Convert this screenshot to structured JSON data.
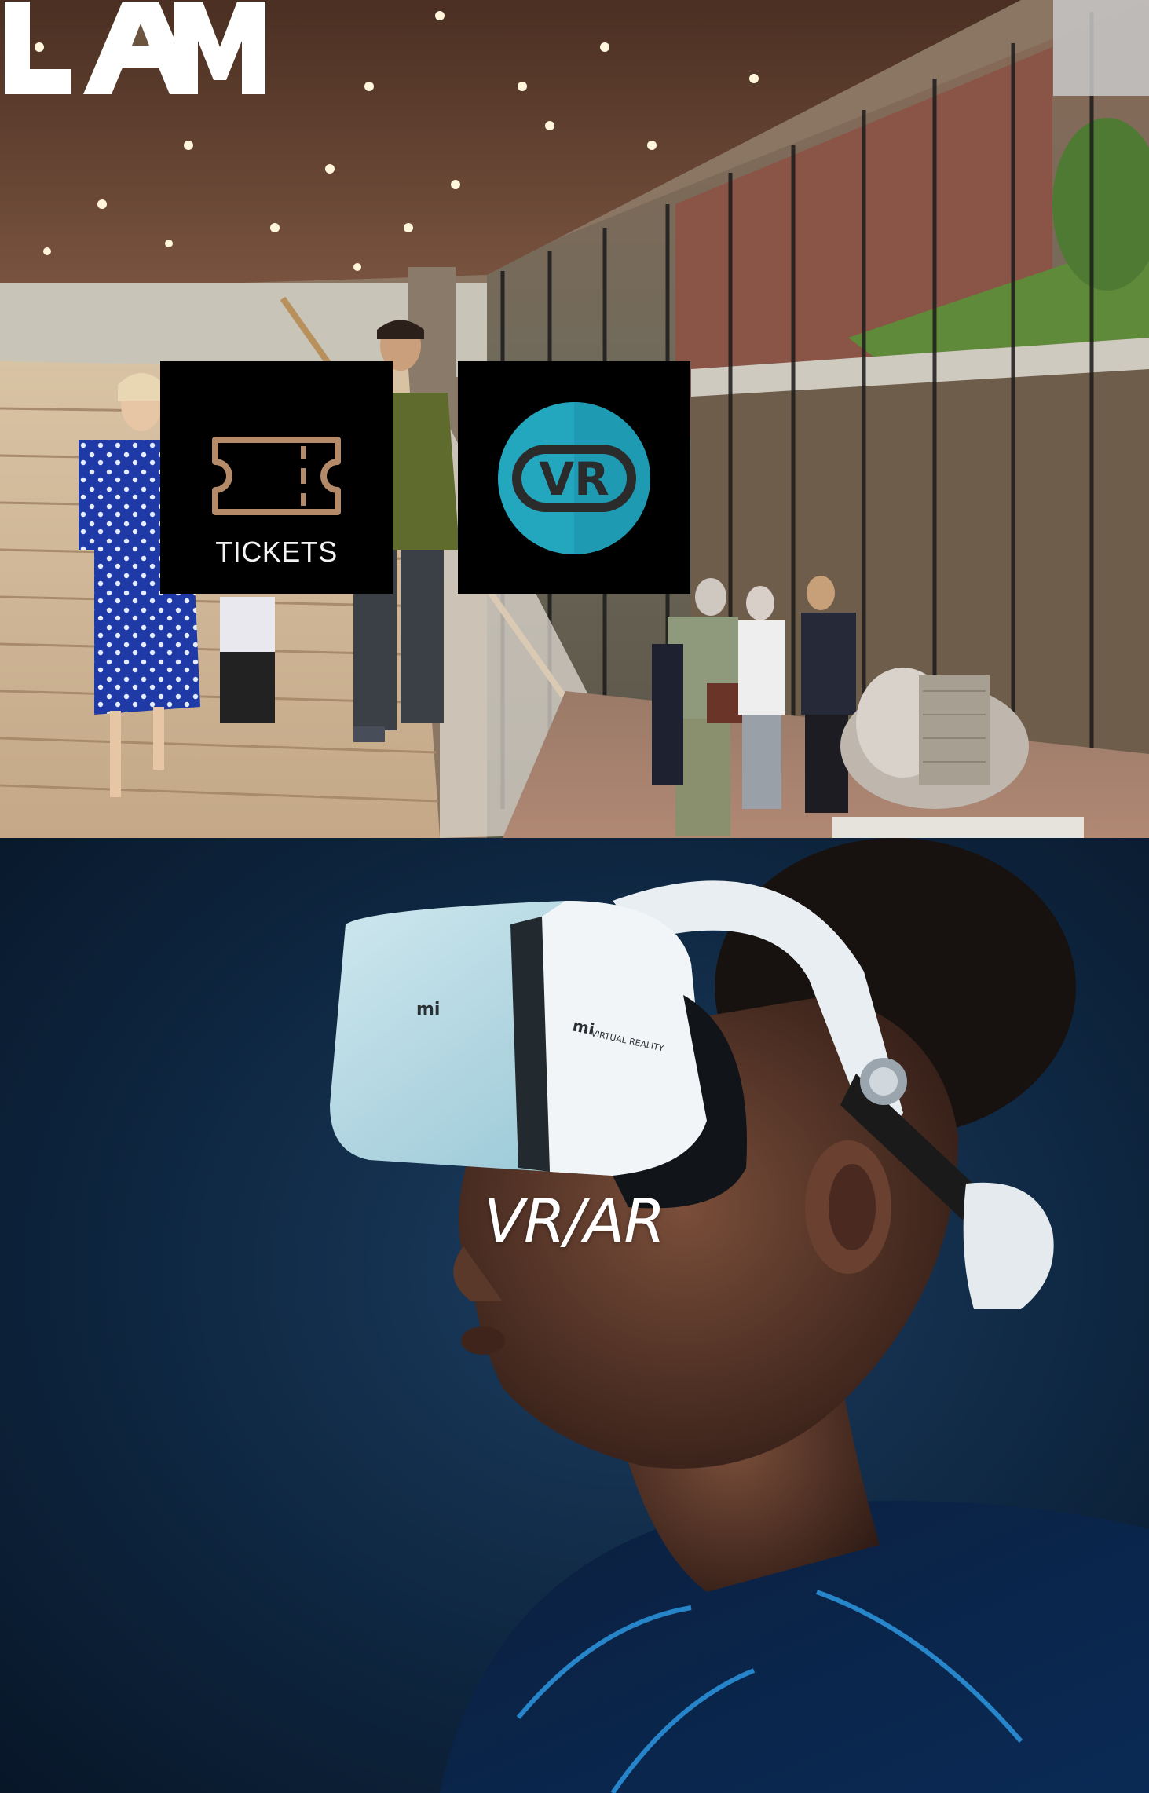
{
  "brand": {
    "logo_text": "LAM"
  },
  "shortcuts": {
    "tickets": {
      "label": "TICKETS",
      "icon": "ticket-icon"
    },
    "vr": {
      "badge_text": "VR",
      "icon": "vr-badge-icon"
    }
  },
  "feature": {
    "title": "VR/AR",
    "headset_brand": "mi",
    "headset_caption": "VIRTUAL REALITY"
  },
  "colors": {
    "ticket_accent": "#b48a68",
    "vr_teal": "#23a7bf",
    "vr_teal_dark": "#1a8aa0",
    "tile_bg": "#000000",
    "night_bg": "#0e2640"
  }
}
